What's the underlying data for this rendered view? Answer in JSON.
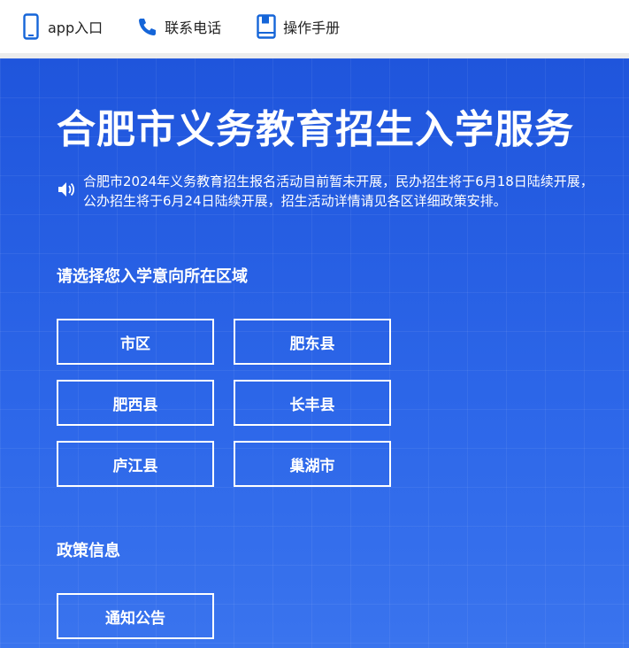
{
  "topbar": {
    "items": [
      {
        "label": "app入口",
        "icon": "phone-icon"
      },
      {
        "label": "联系电话",
        "icon": "telephone-icon"
      },
      {
        "label": "操作手册",
        "icon": "manual-icon"
      }
    ]
  },
  "hero": {
    "title": "合肥市义务教育招生入学服务",
    "notice_line1": "合肥市2024年义务教育招生报名活动目前暂未开展，民办招生将于6月18日陆续开展，",
    "notice_line2": "公办招生将于6月24日陆续开展，招生活动详情请见各区详细政策安排。",
    "area_title": "请选择您入学意向所在区域",
    "areas": [
      "市区",
      "肥东县",
      "肥西县",
      "长丰县",
      "庐江县",
      "巢湖市"
    ],
    "policy_title": "政策信息",
    "policy_items": [
      "通知公告"
    ]
  },
  "colors": {
    "accent": "#1565d8",
    "hero_bg": "#2a63e6",
    "text_on_hero": "#ffffff"
  }
}
